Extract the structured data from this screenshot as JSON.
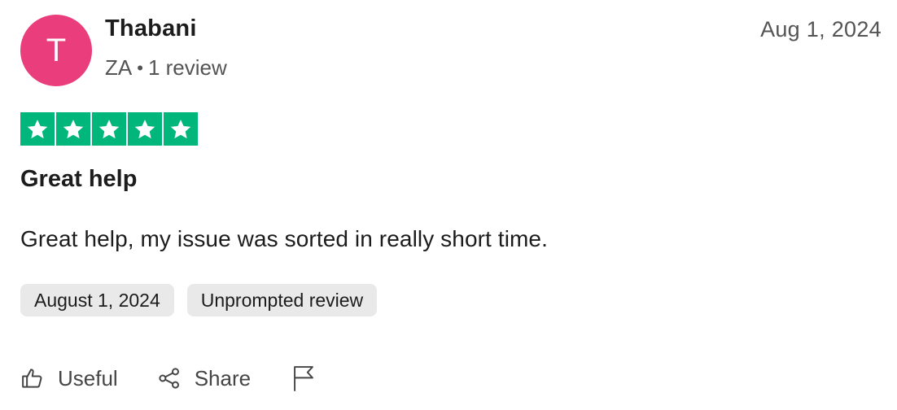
{
  "reviewer": {
    "avatar_initial": "T",
    "name": "Thabani",
    "country": "ZA",
    "separator": "•",
    "review_count": "1 review"
  },
  "review": {
    "date": "Aug 1, 2024",
    "rating": 5,
    "title": "Great help",
    "body": "Great help, my issue was sorted in really short time."
  },
  "tags": [
    {
      "label": "August 1, 2024"
    },
    {
      "label": "Unprompted review"
    }
  ],
  "actions": {
    "useful_label": "Useful",
    "share_label": "Share",
    "useful_icon": "thumbs-up-icon",
    "share_icon": "share-icon",
    "report_icon": "flag-icon"
  },
  "colors": {
    "avatar": "#e93e7b",
    "star_green": "#00b67a",
    "tag_bg": "#e9e9e9"
  }
}
